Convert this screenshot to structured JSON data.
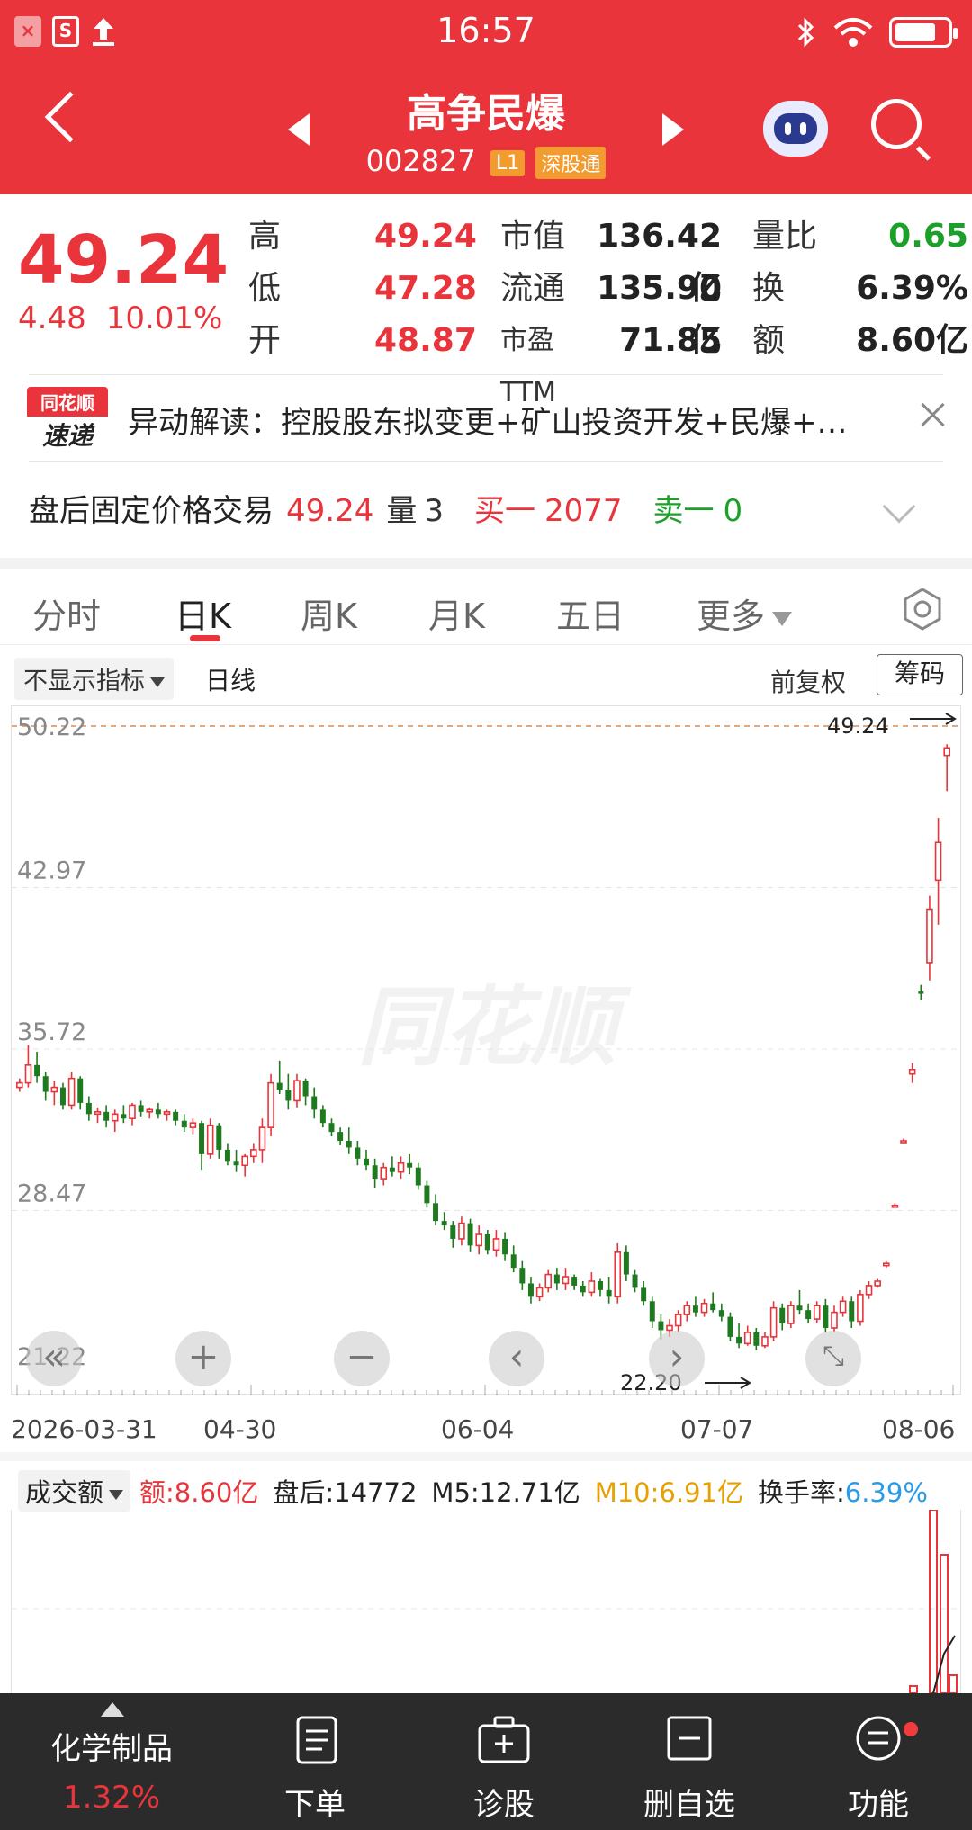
{
  "status_bar": {
    "time": "16:57"
  },
  "header": {
    "stock_name": "高争民爆",
    "stock_code": "002827",
    "tag_level": "L1",
    "tag_connect": "深股通"
  },
  "quote": {
    "price": "49.24",
    "change": "4.48",
    "change_pct": "10.01%",
    "rows": [
      {
        "l1": "高",
        "v1": "49.24",
        "l2": "市值",
        "v2": "136.42亿",
        "l3": "量比",
        "v3": "0.65"
      },
      {
        "l1": "低",
        "v1": "47.28",
        "l2": "流通",
        "v2": "135.90亿",
        "l3": "换",
        "v3": "6.39%"
      },
      {
        "l1": "开",
        "v1": "48.87",
        "l2": "市盈TTM",
        "v2": "71.85",
        "l3": "额",
        "v3": "8.60亿"
      }
    ]
  },
  "news": {
    "logo_top": "同花顺",
    "logo_bottom": "速递",
    "text": "异动解读：控股股东拟变更+矿山投资开发+民爆+…"
  },
  "after_hours": {
    "label": "盘后固定价格交易",
    "price": "49.24",
    "vol_label": "量",
    "vol": "3",
    "buy_label": "买一",
    "buy": "2077",
    "sell_label": "卖一",
    "sell": "0"
  },
  "tabs": [
    "分时",
    "日K",
    "周K",
    "月K",
    "五日",
    "更多"
  ],
  "chart_toolbar": {
    "indicator": "不显示指标",
    "line_type": "日线",
    "adjust": "前复权",
    "chip": "筹码"
  },
  "chart_data": {
    "type": "candlestick",
    "y_ticks": [
      "50.22",
      "42.97",
      "35.72",
      "28.47",
      "21.22"
    ],
    "ylim": [
      21.22,
      50.22
    ],
    "x_ticks": [
      "2026-03-31",
      "04-30",
      "06-04",
      "07-07",
      "08-06"
    ],
    "max_label": "49.24",
    "min_label": "22.20",
    "watermark": "同花顺",
    "candles": [
      [
        34.0,
        34.4,
        33.8,
        34.2
      ],
      [
        34.2,
        35.9,
        34.0,
        35.0
      ],
      [
        35.0,
        35.6,
        34.2,
        34.5
      ],
      [
        34.5,
        34.7,
        33.4,
        33.8
      ],
      [
        33.8,
        34.3,
        33.2,
        34.0
      ],
      [
        34.0,
        34.2,
        33.0,
        33.2
      ],
      [
        33.2,
        34.7,
        33.0,
        34.4
      ],
      [
        34.4,
        34.5,
        33.0,
        33.3
      ],
      [
        33.3,
        33.6,
        32.5,
        32.8
      ],
      [
        32.8,
        33.1,
        32.4,
        32.9
      ],
      [
        32.9,
        33.2,
        32.2,
        32.5
      ],
      [
        32.5,
        33.0,
        32.0,
        32.8
      ],
      [
        32.8,
        33.2,
        32.4,
        32.6
      ],
      [
        32.6,
        33.3,
        32.3,
        33.2
      ],
      [
        33.2,
        33.4,
        32.7,
        32.9
      ],
      [
        32.9,
        33.1,
        32.6,
        33.0
      ],
      [
        33.0,
        33.3,
        32.6,
        32.8
      ],
      [
        32.8,
        33.0,
        32.5,
        32.9
      ],
      [
        32.9,
        33.0,
        32.3,
        32.5
      ],
      [
        32.5,
        32.8,
        32.0,
        32.2
      ],
      [
        32.2,
        32.6,
        31.9,
        32.4
      ],
      [
        32.4,
        32.5,
        30.3,
        31.0
      ],
      [
        31.0,
        32.6,
        30.8,
        32.3
      ],
      [
        32.3,
        32.4,
        30.8,
        31.2
      ],
      [
        31.2,
        31.5,
        30.5,
        30.7
      ],
      [
        30.7,
        31.2,
        30.2,
        30.5
      ],
      [
        30.5,
        31.0,
        30.0,
        30.9
      ],
      [
        30.9,
        31.5,
        30.6,
        31.2
      ],
      [
        31.2,
        32.6,
        30.6,
        32.2
      ],
      [
        32.2,
        34.6,
        31.8,
        34.2
      ],
      [
        34.2,
        35.2,
        33.7,
        33.9
      ],
      [
        33.9,
        34.6,
        33.0,
        33.4
      ],
      [
        33.4,
        34.6,
        33.1,
        34.3
      ],
      [
        34.3,
        34.4,
        33.2,
        33.6
      ],
      [
        33.6,
        34.0,
        32.6,
        33.0
      ],
      [
        33.0,
        33.2,
        32.2,
        32.4
      ],
      [
        32.4,
        32.6,
        31.8,
        32.0
      ],
      [
        32.0,
        32.2,
        31.4,
        31.6
      ],
      [
        31.6,
        32.2,
        31.0,
        31.3
      ],
      [
        31.3,
        31.6,
        30.5,
        30.8
      ],
      [
        30.8,
        31.2,
        30.3,
        30.5
      ],
      [
        30.5,
        30.8,
        29.5,
        29.9
      ],
      [
        29.9,
        30.6,
        29.6,
        30.4
      ],
      [
        30.4,
        30.9,
        30.0,
        30.2
      ],
      [
        30.2,
        30.9,
        29.9,
        30.6
      ],
      [
        30.6,
        31.0,
        30.1,
        30.4
      ],
      [
        30.4,
        30.6,
        29.4,
        29.6
      ],
      [
        29.6,
        29.8,
        28.6,
        28.8
      ],
      [
        28.8,
        29.2,
        27.8,
        28.0
      ],
      [
        28.0,
        28.4,
        27.6,
        27.8
      ],
      [
        27.8,
        28.0,
        26.8,
        27.2
      ],
      [
        27.2,
        28.2,
        26.9,
        27.9
      ],
      [
        27.9,
        28.1,
        26.6,
        26.9
      ],
      [
        26.9,
        27.8,
        26.5,
        27.4
      ],
      [
        27.4,
        27.6,
        26.5,
        26.7
      ],
      [
        26.7,
        27.6,
        26.4,
        27.2
      ],
      [
        27.2,
        27.5,
        26.2,
        26.5
      ],
      [
        26.5,
        26.9,
        25.7,
        25.9
      ],
      [
        25.9,
        26.2,
        24.9,
        25.2
      ],
      [
        25.2,
        25.5,
        24.3,
        24.6
      ],
      [
        24.6,
        25.2,
        24.4,
        25.0
      ],
      [
        25.0,
        25.8,
        24.8,
        25.6
      ],
      [
        25.6,
        25.9,
        24.9,
        25.2
      ],
      [
        25.2,
        25.9,
        24.9,
        25.5
      ],
      [
        25.5,
        25.6,
        24.9,
        25.1
      ],
      [
        25.1,
        25.3,
        24.6,
        24.8
      ],
      [
        24.8,
        25.7,
        24.6,
        25.3
      ],
      [
        25.3,
        25.4,
        24.6,
        24.9
      ],
      [
        24.9,
        25.5,
        24.3,
        24.6
      ],
      [
        24.6,
        27.0,
        24.3,
        26.6
      ],
      [
        26.6,
        26.9,
        25.3,
        25.6
      ],
      [
        25.6,
        25.8,
        24.8,
        25.0
      ],
      [
        25.0,
        25.3,
        24.2,
        24.4
      ],
      [
        24.4,
        24.6,
        23.2,
        23.5
      ],
      [
        23.5,
        23.8,
        22.7,
        23.1
      ],
      [
        23.1,
        23.6,
        22.8,
        23.3
      ],
      [
        23.3,
        24.0,
        23.0,
        23.8
      ],
      [
        23.8,
        24.4,
        23.5,
        24.2
      ],
      [
        24.2,
        24.6,
        23.7,
        23.9
      ],
      [
        23.9,
        24.5,
        23.7,
        24.3
      ],
      [
        24.3,
        24.8,
        23.9,
        24.0
      ],
      [
        24.0,
        24.3,
        23.5,
        23.7
      ],
      [
        23.7,
        23.9,
        22.6,
        22.8
      ],
      [
        22.8,
        23.4,
        22.3,
        22.5
      ],
      [
        22.5,
        23.3,
        22.4,
        23.0
      ],
      [
        23.0,
        23.2,
        22.2,
        22.4
      ],
      [
        22.4,
        23.0,
        22.3,
        22.8
      ],
      [
        22.8,
        24.4,
        22.6,
        24.1
      ],
      [
        24.1,
        24.3,
        23.1,
        23.4
      ],
      [
        23.4,
        24.4,
        23.2,
        24.2
      ],
      [
        24.2,
        24.9,
        23.8,
        24.0
      ],
      [
        24.0,
        24.3,
        23.4,
        23.6
      ],
      [
        23.6,
        24.4,
        23.4,
        24.2
      ],
      [
        24.2,
        24.5,
        23.0,
        23.2
      ],
      [
        23.2,
        24.2,
        23.0,
        23.9
      ],
      [
        23.9,
        24.6,
        23.7,
        24.4
      ],
      [
        24.4,
        24.6,
        23.2,
        23.5
      ],
      [
        23.5,
        24.9,
        23.3,
        24.7
      ],
      [
        24.7,
        25.3,
        24.5,
        25.1
      ],
      [
        25.1,
        25.4,
        25.0,
        25.3
      ],
      [
        26.0,
        26.2,
        25.9,
        26.1
      ],
      [
        28.7,
        28.8,
        28.6,
        28.7
      ],
      [
        31.6,
        31.7,
        31.5,
        31.6
      ],
      [
        34.6,
        35.1,
        34.2,
        34.8
      ],
      [
        38.3,
        38.6,
        37.9,
        38.2
      ],
      [
        39.6,
        42.6,
        38.8,
        42.0
      ],
      [
        43.3,
        46.1,
        41.3,
        45.0
      ],
      [
        48.9,
        49.4,
        47.3,
        49.24
      ]
    ]
  },
  "volume": {
    "indicator": "成交额",
    "amount_label": "额:",
    "amount": "8.60亿",
    "after_label": "盘后:",
    "after": "14772",
    "m5_label": "M5:",
    "m5": "12.71亿",
    "m10_label": "M10:",
    "m10": "6.91亿",
    "turnover_label": "换手率:",
    "turnover": "6.39%"
  },
  "bottom_nav": {
    "industry_name": "化学制品",
    "industry_pct": "1.32%",
    "items": [
      "下单",
      "诊股",
      "删自选",
      "功能"
    ]
  },
  "colors": {
    "brand_red": "#e8343a",
    "up": "#e8343a",
    "down": "#1e7a1e",
    "m5": "#222222",
    "m10": "#e6a100",
    "turnover": "#2a9be8"
  }
}
